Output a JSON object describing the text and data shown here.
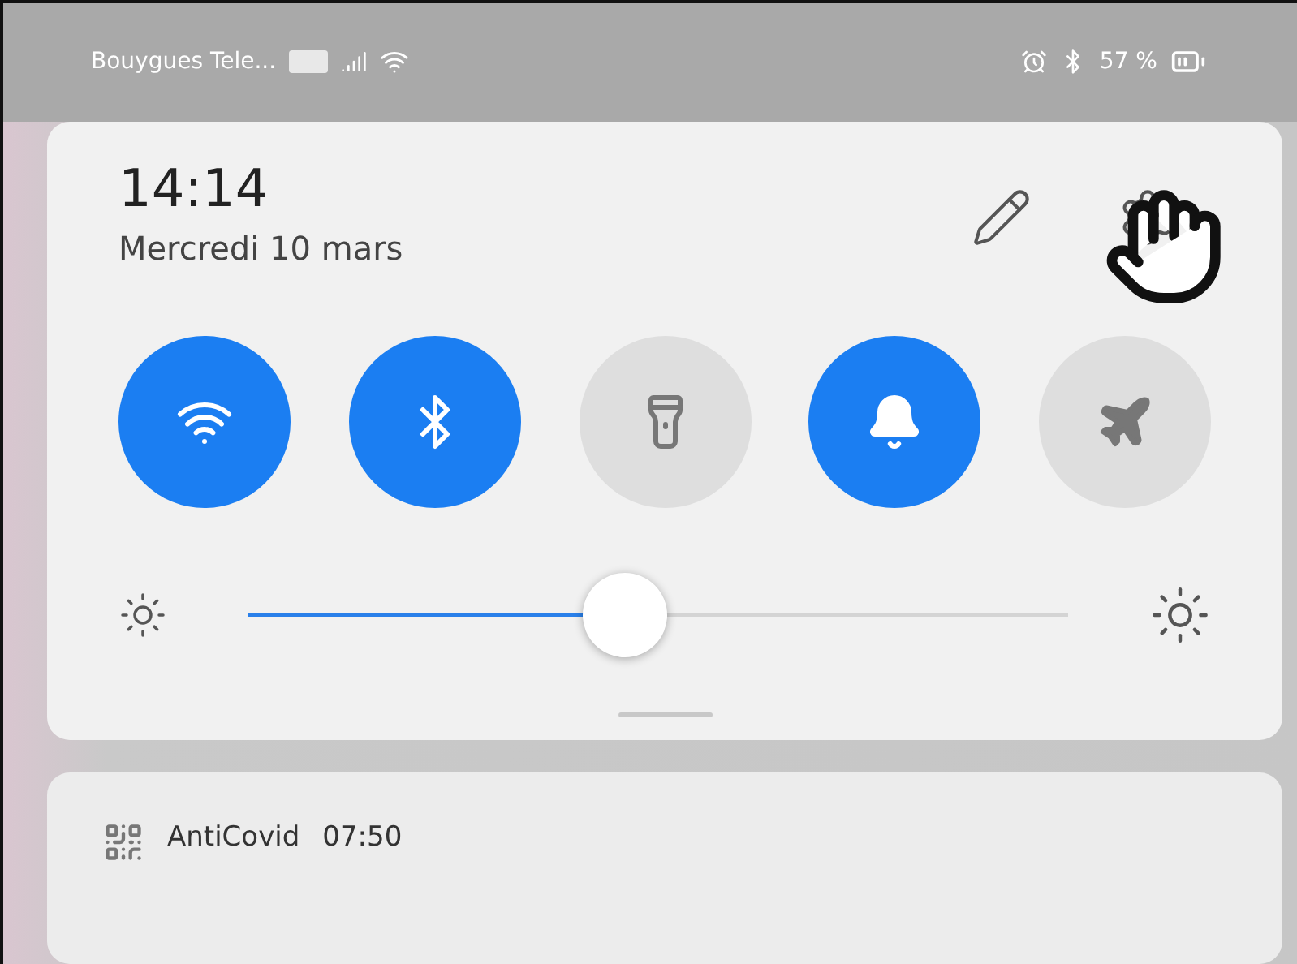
{
  "status_bar": {
    "carrier": "Bouygues Tele...",
    "battery": "57 %"
  },
  "quick_panel": {
    "time": "14:14",
    "date": "Mercredi 10 mars",
    "toggles": [
      {
        "kind": "wifi",
        "on": true
      },
      {
        "kind": "bluetooth",
        "on": true
      },
      {
        "kind": "flashlight",
        "on": false
      },
      {
        "kind": "sound",
        "on": true
      },
      {
        "kind": "airplane",
        "on": false
      }
    ],
    "brightness": {
      "level": 0.46
    }
  },
  "notification": {
    "app": "AntiCovid",
    "time": "07:50"
  }
}
